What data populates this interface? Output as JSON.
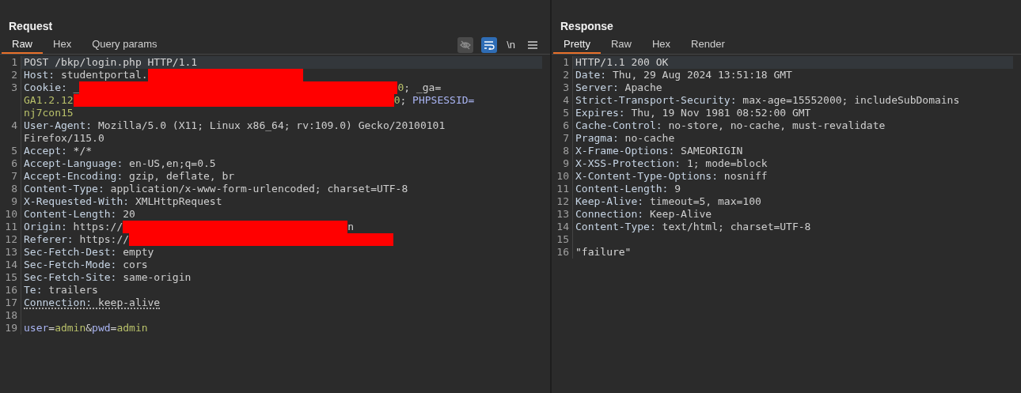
{
  "request": {
    "title": "Request",
    "tabs": [
      {
        "label": "Raw",
        "selected": true
      },
      {
        "label": "Hex",
        "selected": false
      },
      {
        "label": "Query params",
        "selected": false
      }
    ],
    "toolbar": [
      {
        "kind": "hide",
        "on": false
      },
      {
        "kind": "wrap",
        "on": true
      },
      {
        "kind": "newline",
        "label": "\\n"
      },
      {
        "kind": "menu"
      }
    ],
    "lines": [
      {
        "num": "1",
        "highlighted": true,
        "rows": [
          [
            {
              "kind": "plain",
              "text": "POST /bkp/login.php HTTP/1.1"
            }
          ]
        ]
      },
      {
        "num": "2",
        "highlighted": false,
        "rows": [
          [
            {
              "kind": "name",
              "text": "Host:"
            },
            {
              "kind": "value",
              "text": " studentportal."
            },
            {
              "kind": "redacted"
            }
          ]
        ]
      },
      {
        "num": "3",
        "highlighted": false,
        "rows": [
          [
            {
              "kind": "name",
              "text": "Cookie:"
            },
            {
              "kind": "value",
              "text": " _"
            },
            {
              "kind": "redacted"
            },
            {
              "kind": "cookie",
              "text": "0"
            },
            {
              "kind": "value",
              "text": "; _ga="
            }
          ],
          [
            {
              "kind": "cookie",
              "text": "GA1.2.12"
            },
            {
              "kind": "redacted"
            },
            {
              "kind": "cookie",
              "text": "0"
            },
            {
              "kind": "value",
              "text": "; "
            },
            {
              "kind": "param",
              "text": "PHPSESSID="
            }
          ],
          [
            {
              "kind": "cookie",
              "text": "nj7con15"
            }
          ]
        ]
      },
      {
        "num": "4",
        "highlighted": false,
        "rows": [
          [
            {
              "kind": "name",
              "text": "User-Agent:"
            },
            {
              "kind": "value",
              "text": " Mozilla/5.0 (X11; Linux x86_64; rv:109.0) Gecko/20100101"
            }
          ],
          [
            {
              "kind": "value",
              "text": "Firefox/115.0"
            }
          ]
        ]
      },
      {
        "num": "5",
        "highlighted": false,
        "rows": [
          [
            {
              "kind": "name",
              "text": "Accept:"
            },
            {
              "kind": "value",
              "text": " */*"
            }
          ]
        ]
      },
      {
        "num": "6",
        "highlighted": false,
        "rows": [
          [
            {
              "kind": "name",
              "text": "Accept-Language:"
            },
            {
              "kind": "value",
              "text": " en-US,en;q=0.5"
            }
          ]
        ]
      },
      {
        "num": "7",
        "highlighted": false,
        "rows": [
          [
            {
              "kind": "name",
              "text": "Accept-Encoding:"
            },
            {
              "kind": "value",
              "text": " gzip, deflate, br"
            }
          ]
        ]
      },
      {
        "num": "8",
        "highlighted": false,
        "rows": [
          [
            {
              "kind": "name",
              "text": "Content-Type:"
            },
            {
              "kind": "value",
              "text": " application/x-www-form-urlencoded; charset=UTF-8"
            }
          ]
        ]
      },
      {
        "num": "9",
        "highlighted": false,
        "rows": [
          [
            {
              "kind": "name",
              "text": "X-Requested-With:"
            },
            {
              "kind": "value",
              "text": " XMLHttpRequest"
            }
          ]
        ]
      },
      {
        "num": "10",
        "highlighted": false,
        "rows": [
          [
            {
              "kind": "name",
              "text": "Content-Length:"
            },
            {
              "kind": "value",
              "text": " 20"
            }
          ]
        ]
      },
      {
        "num": "11",
        "highlighted": false,
        "rows": [
          [
            {
              "kind": "name",
              "text": "Origin:"
            },
            {
              "kind": "value",
              "text": " https://"
            },
            {
              "kind": "redacted"
            },
            {
              "kind": "value",
              "text": "n"
            }
          ]
        ]
      },
      {
        "num": "12",
        "highlighted": false,
        "rows": [
          [
            {
              "kind": "name",
              "text": "Referer:"
            },
            {
              "kind": "value",
              "text": " https://"
            },
            {
              "kind": "redacted"
            }
          ]
        ]
      },
      {
        "num": "13",
        "highlighted": false,
        "rows": [
          [
            {
              "kind": "name",
              "text": "Sec-Fetch-Dest:"
            },
            {
              "kind": "value",
              "text": " empty"
            }
          ]
        ]
      },
      {
        "num": "14",
        "highlighted": false,
        "rows": [
          [
            {
              "kind": "name",
              "text": "Sec-Fetch-Mode:"
            },
            {
              "kind": "value",
              "text": " cors"
            }
          ]
        ]
      },
      {
        "num": "15",
        "highlighted": false,
        "rows": [
          [
            {
              "kind": "name",
              "text": "Sec-Fetch-Site:"
            },
            {
              "kind": "value",
              "text": " same-origin"
            }
          ]
        ]
      },
      {
        "num": "16",
        "highlighted": false,
        "rows": [
          [
            {
              "kind": "name",
              "text": "Te:"
            },
            {
              "kind": "value",
              "text": " trailers"
            }
          ]
        ]
      },
      {
        "num": "17",
        "highlighted": false,
        "underlined": true,
        "rows": [
          [
            {
              "kind": "name",
              "text": "Connection:"
            },
            {
              "kind": "value",
              "text": " keep-alive"
            }
          ]
        ]
      },
      {
        "num": "18",
        "highlighted": false
      },
      {
        "num": "19",
        "highlighted": false,
        "rows": [
          [
            {
              "kind": "param",
              "text": "user"
            },
            {
              "kind": "value",
              "text": "="
            },
            {
              "kind": "cookie",
              "text": "admin"
            },
            {
              "kind": "value",
              "text": "&"
            },
            {
              "kind": "param",
              "text": "pwd"
            },
            {
              "kind": "value",
              "text": "="
            },
            {
              "kind": "cookie",
              "text": "admin"
            }
          ]
        ]
      }
    ]
  },
  "response": {
    "title": "Response",
    "tabs": [
      {
        "label": "Pretty",
        "selected": true
      },
      {
        "label": "Raw",
        "selected": false
      },
      {
        "label": "Hex",
        "selected": false
      },
      {
        "label": "Render",
        "selected": false
      }
    ],
    "lines": [
      {
        "num": "1",
        "highlighted": true,
        "rows": [
          [
            {
              "kind": "plain",
              "text": "HTTP/1.1 200 OK"
            }
          ]
        ]
      },
      {
        "num": "2",
        "highlighted": false,
        "rows": [
          [
            {
              "kind": "name",
              "text": "Date:"
            },
            {
              "kind": "value",
              "text": " Thu, 29 Aug 2024 13:51:18 GMT"
            }
          ]
        ]
      },
      {
        "num": "3",
        "highlighted": false,
        "rows": [
          [
            {
              "kind": "name",
              "text": "Server:"
            },
            {
              "kind": "value",
              "text": " Apache"
            }
          ]
        ]
      },
      {
        "num": "4",
        "highlighted": false,
        "rows": [
          [
            {
              "kind": "name",
              "text": "Strict-Transport-Security:"
            },
            {
              "kind": "value",
              "text": " max-age=15552000; includeSubDomains"
            }
          ]
        ]
      },
      {
        "num": "5",
        "highlighted": false,
        "rows": [
          [
            {
              "kind": "name",
              "text": "Expires:"
            },
            {
              "kind": "value",
              "text": " Thu, 19 Nov 1981 08:52:00 GMT"
            }
          ]
        ]
      },
      {
        "num": "6",
        "highlighted": false,
        "rows": [
          [
            {
              "kind": "name",
              "text": "Cache-Control:"
            },
            {
              "kind": "value",
              "text": " no-store, no-cache, must-revalidate"
            }
          ]
        ]
      },
      {
        "num": "7",
        "highlighted": false,
        "rows": [
          [
            {
              "kind": "name",
              "text": "Pragma:"
            },
            {
              "kind": "value",
              "text": " no-cache"
            }
          ]
        ]
      },
      {
        "num": "8",
        "highlighted": false,
        "rows": [
          [
            {
              "kind": "name",
              "text": "X-Frame-Options:"
            },
            {
              "kind": "value",
              "text": " SAMEORIGIN"
            }
          ]
        ]
      },
      {
        "num": "9",
        "highlighted": false,
        "rows": [
          [
            {
              "kind": "name",
              "text": "X-XSS-Protection:"
            },
            {
              "kind": "value",
              "text": " 1; mode=block"
            }
          ]
        ]
      },
      {
        "num": "10",
        "highlighted": false,
        "rows": [
          [
            {
              "kind": "name",
              "text": "X-Content-Type-Options:"
            },
            {
              "kind": "value",
              "text": " nosniff"
            }
          ]
        ]
      },
      {
        "num": "11",
        "highlighted": false,
        "rows": [
          [
            {
              "kind": "name",
              "text": "Content-Length:"
            },
            {
              "kind": "value",
              "text": " 9"
            }
          ]
        ]
      },
      {
        "num": "12",
        "highlighted": false,
        "rows": [
          [
            {
              "kind": "name",
              "text": "Keep-Alive:"
            },
            {
              "kind": "value",
              "text": " timeout=5, max=100"
            }
          ]
        ]
      },
      {
        "num": "13",
        "highlighted": false,
        "rows": [
          [
            {
              "kind": "name",
              "text": "Connection:"
            },
            {
              "kind": "value",
              "text": " Keep-Alive"
            }
          ]
        ]
      },
      {
        "num": "14",
        "highlighted": false,
        "rows": [
          [
            {
              "kind": "name",
              "text": "Content-Type:"
            },
            {
              "kind": "value",
              "text": " text/html; charset=UTF-8"
            }
          ]
        ]
      },
      {
        "num": "15",
        "highlighted": false
      },
      {
        "num": "16",
        "highlighted": false,
        "rows": [
          [
            {
              "kind": "plain",
              "text": "\"failure\""
            }
          ]
        ]
      }
    ]
  }
}
